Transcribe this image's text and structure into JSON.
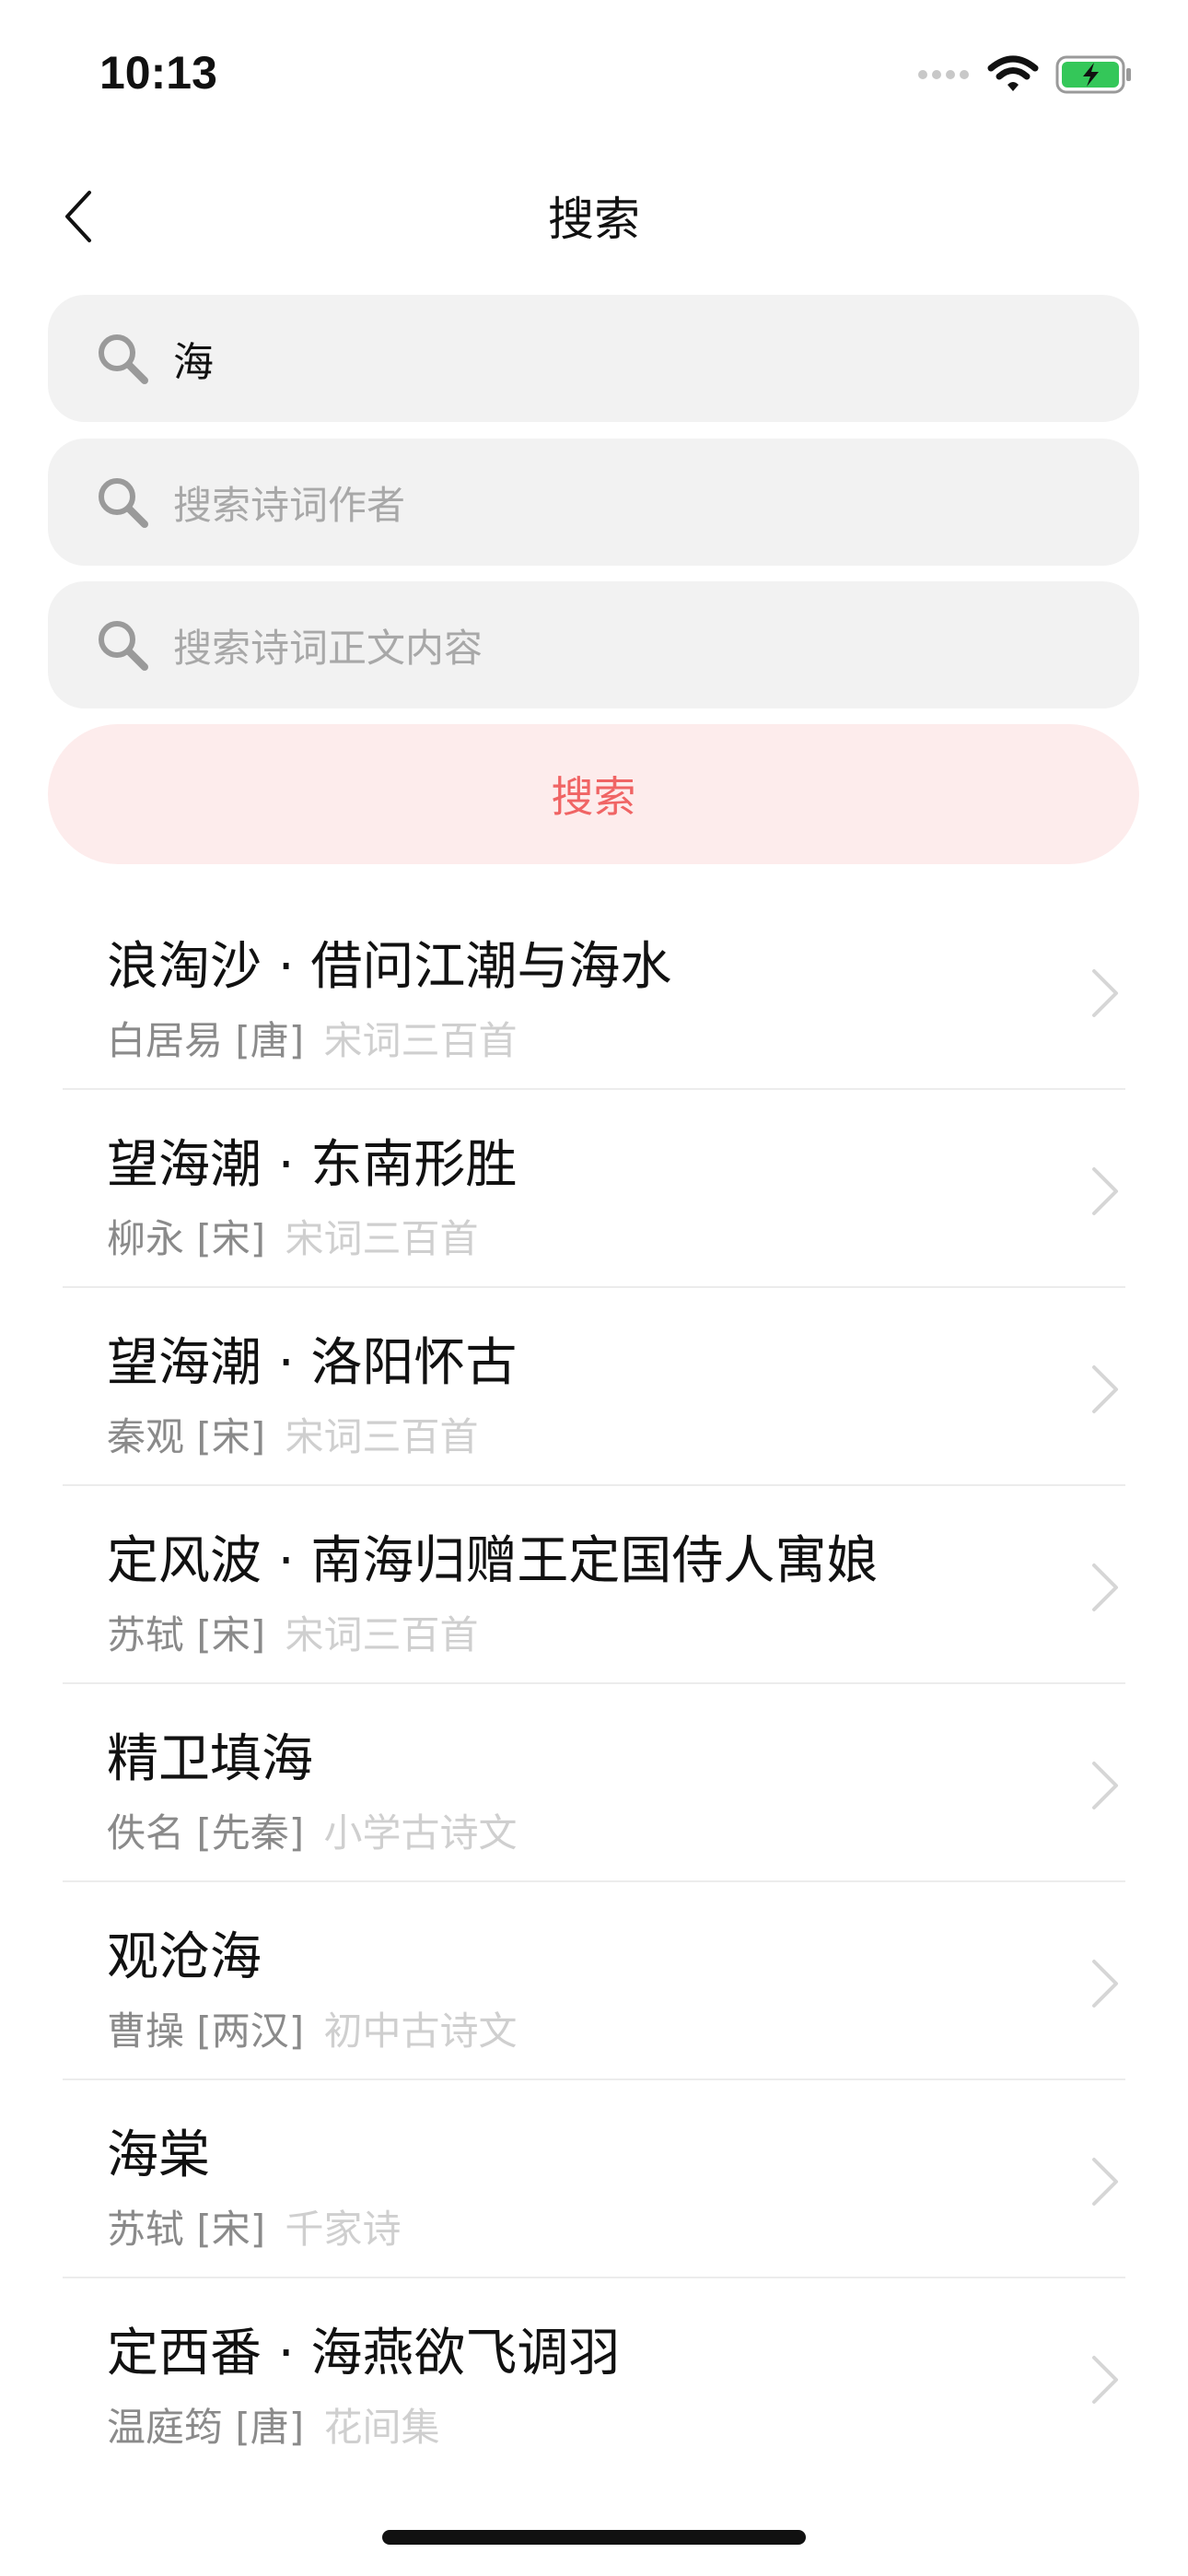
{
  "status_bar": {
    "time": "10:13"
  },
  "nav": {
    "title": "搜索"
  },
  "search": {
    "title_query": "海",
    "author_placeholder": "搜索诗词作者",
    "content_placeholder": "搜索诗词正文内容",
    "button_label": "搜索"
  },
  "results": [
    {
      "title": "浪淘沙 · 借问江潮与海水",
      "author": "白居易",
      "dynasty": "[唐]",
      "collection": "宋词三百首"
    },
    {
      "title": "望海潮 · 东南形胜",
      "author": "柳永",
      "dynasty": "[宋]",
      "collection": "宋词三百首"
    },
    {
      "title": "望海潮 · 洛阳怀古",
      "author": "秦观",
      "dynasty": "[宋]",
      "collection": "宋词三百首"
    },
    {
      "title": "定风波 · 南海归赠王定国侍人寓娘",
      "author": "苏轼",
      "dynasty": "[宋]",
      "collection": "宋词三百首"
    },
    {
      "title": "精卫填海",
      "author": "佚名",
      "dynasty": "[先秦]",
      "collection": "小学古诗文"
    },
    {
      "title": "观沧海",
      "author": "曹操",
      "dynasty": "[两汉]",
      "collection": "初中古诗文"
    },
    {
      "title": "海棠",
      "author": "苏轼",
      "dynasty": "[宋]",
      "collection": "千家诗"
    },
    {
      "title": "定西番 · 海燕欲飞调羽",
      "author": "温庭筠",
      "dynasty": "[唐]",
      "collection": "花间集"
    }
  ],
  "colors": {
    "accent": "#f06464",
    "button_bg": "#fdecec",
    "field_bg": "#f2f2f2",
    "battery": "#34c759"
  },
  "icons": {
    "back": "chevron-left-icon",
    "search": "magnifier-icon",
    "row": "chevron-right-icon"
  }
}
